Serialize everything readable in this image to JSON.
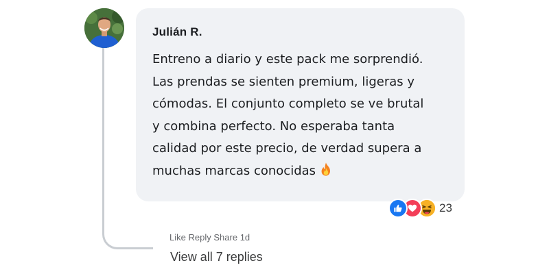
{
  "comment": {
    "author": "Julián R.",
    "text": "Entreno a diario y este pack me sorprendió.\nLas prendas se sienten premium, ligeras y\ncómodas. El conjunto completo se ve brutal\ny combina perfecto. No esperaba tanta\ncalidad por este precio, de verdad supera a\nmuchas marcas conocidas",
    "emoji": "fire-icon"
  },
  "reactions": {
    "icons": [
      "like-icon",
      "love-icon",
      "haha-icon"
    ],
    "count": "23",
    "colors": {
      "like": "#1877f2",
      "love": "#f33e58",
      "haha": "#f7b125"
    }
  },
  "actions": {
    "like": "Like",
    "reply": "Reply",
    "share": "Share",
    "time": "1d"
  },
  "replies": {
    "label": "View all 7 replies"
  }
}
